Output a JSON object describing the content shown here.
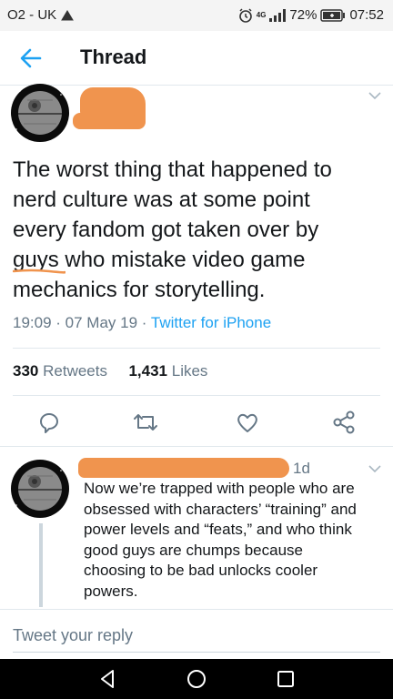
{
  "status_bar": {
    "carrier": "O2 - UK",
    "network": "4G",
    "battery": "72%",
    "time": "07:52"
  },
  "header": {
    "title": "Thread"
  },
  "tweet": {
    "text_lines": [
      "The worst thing that happened to",
      "nerd culture was at some point",
      "every fandom got taken over by",
      "guys who mistake video game",
      "mechanics for storytelling."
    ],
    "time": "19:09",
    "date": "07 May 19",
    "source": "Twitter for iPhone",
    "retweets_count": "330",
    "retweets_label": "Retweets",
    "likes_count": "1,431",
    "likes_label": "Likes"
  },
  "reply": {
    "time": "1d",
    "text_lines": [
      "Now we’re trapped with people who are",
      "obsessed with characters’ “training” and",
      "power levels and “feats,” and who think",
      "good guys are chumps because",
      "choosing to be bad unlocks cooler",
      "powers."
    ]
  },
  "compose": {
    "placeholder": "Tweet your reply"
  },
  "colors": {
    "accent": "#1da1f2",
    "redaction": "#f0944e",
    "secondary_text": "#657786"
  }
}
